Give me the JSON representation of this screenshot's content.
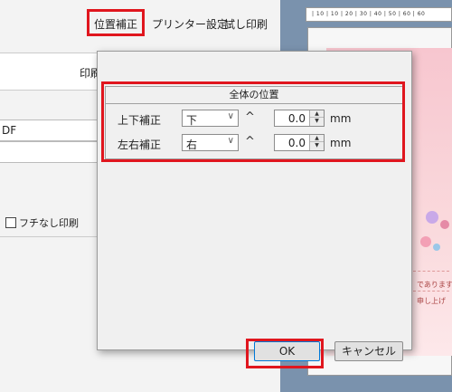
{
  "menubar": {
    "items": [
      "位置補正",
      "プリンター設定",
      "試し印刷"
    ]
  },
  "left_panel": {
    "tab_label": "印刷",
    "field1_text": "DF",
    "borderless_label": "フチなし印刷"
  },
  "preview": {
    "ruler_text": "| 10 | 10 | 20 | 30 | 40 | 50 | 60 | 60",
    "card_chars": [
      "印",
      "香"
    ],
    "card_small": [
      "であります",
      "申し上げ"
    ]
  },
  "dialog": {
    "group_title": "全体の位置",
    "rows": [
      {
        "label": "上下補正",
        "direction": "下",
        "value": "0.0",
        "unit": "mm"
      },
      {
        "label": "左右補正",
        "direction": "右",
        "value": "0.0",
        "unit": "mm"
      }
    ],
    "ok_label": "OK",
    "cancel_label": "キャンセル"
  },
  "colors": {
    "highlight": "#e0161e",
    "preview_bg": "#7a92ad",
    "card_pink": "#f7c6cf"
  }
}
